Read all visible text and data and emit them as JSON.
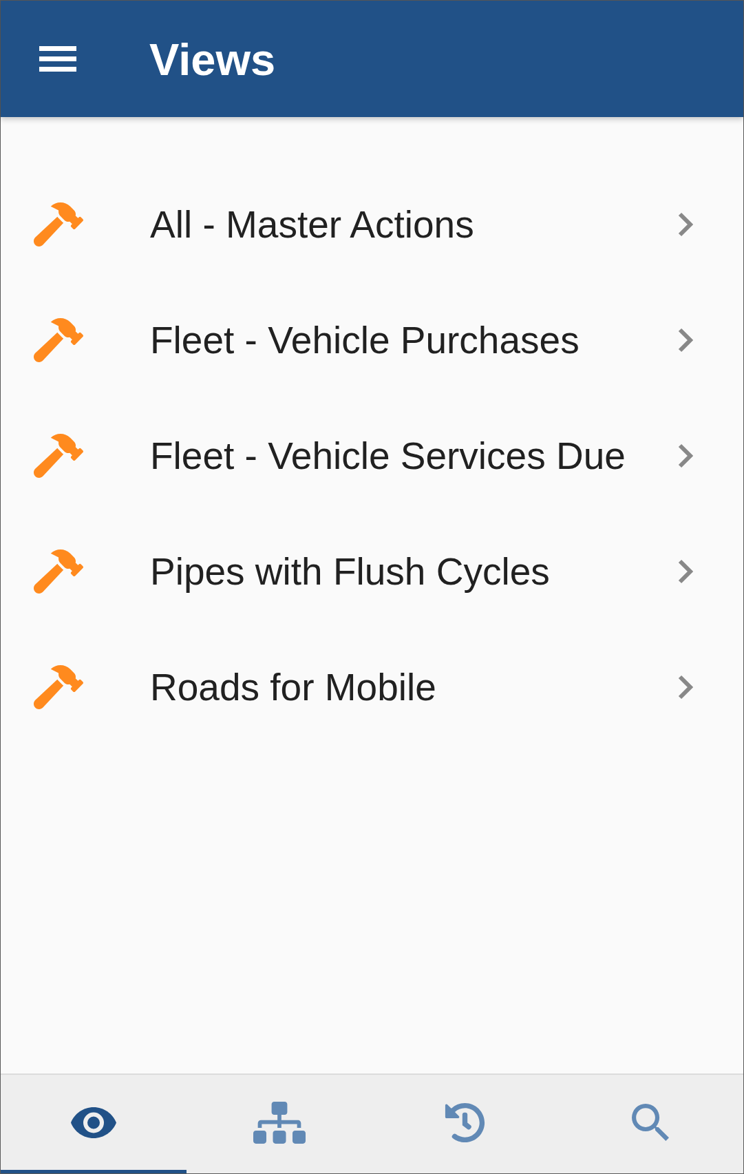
{
  "app_bar": {
    "title": "Views"
  },
  "views": [
    {
      "label": "All - Master Actions"
    },
    {
      "label": "Fleet - Vehicle Purchases"
    },
    {
      "label": "Fleet - Vehicle Services Due"
    },
    {
      "label": "Pipes with Flush Cycles"
    },
    {
      "label": "Roads for Mobile"
    }
  ],
  "bottom_nav": [
    {
      "kind": "eye",
      "selected": true
    },
    {
      "kind": "tree",
      "selected": false
    },
    {
      "kind": "history",
      "selected": false
    },
    {
      "kind": "search",
      "selected": false
    }
  ]
}
